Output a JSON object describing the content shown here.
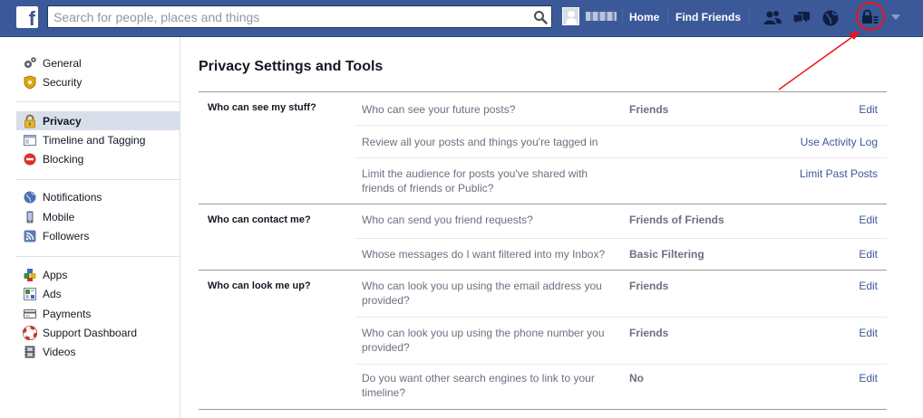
{
  "topbar": {
    "logo": "f",
    "search_placeholder": "Search for people, places and things",
    "home_label": "Home",
    "find_friends_label": "Find Friends",
    "icons": [
      "friend-requests-icon",
      "messages-icon",
      "notifications-globe-icon",
      "privacy-shortcuts-lock-icon",
      "account-menu-arrow-icon"
    ],
    "brand_color": "#3b5998"
  },
  "sidebar": {
    "groups": [
      [
        {
          "label": "General",
          "icon": "gear-icon",
          "selected": false
        },
        {
          "label": "Security",
          "icon": "security-badge-icon",
          "selected": false
        }
      ],
      [
        {
          "label": "Privacy",
          "icon": "lock-icon",
          "selected": true
        },
        {
          "label": "Timeline and Tagging",
          "icon": "timeline-icon",
          "selected": false
        },
        {
          "label": "Blocking",
          "icon": "block-icon",
          "selected": false
        }
      ],
      [
        {
          "label": "Notifications",
          "icon": "globe-icon",
          "selected": false
        },
        {
          "label": "Mobile",
          "icon": "mobile-icon",
          "selected": false
        },
        {
          "label": "Followers",
          "icon": "rss-icon",
          "selected": false
        }
      ],
      [
        {
          "label": "Apps",
          "icon": "apps-cube-icon",
          "selected": false
        },
        {
          "label": "Ads",
          "icon": "ads-icon",
          "selected": false
        },
        {
          "label": "Payments",
          "icon": "credit-card-icon",
          "selected": false
        },
        {
          "label": "Support Dashboard",
          "icon": "lifebuoy-icon",
          "selected": false
        },
        {
          "label": "Videos",
          "icon": "film-icon",
          "selected": false
        }
      ]
    ]
  },
  "main": {
    "title": "Privacy Settings and Tools",
    "sections": [
      {
        "title": "Who can see my stuff?",
        "rows": [
          {
            "question": "Who can see your future posts?",
            "value": "Friends",
            "action": "Edit"
          },
          {
            "question": "Review all your posts and things you're tagged in",
            "value": "",
            "action": "Use Activity Log"
          },
          {
            "question": "Limit the audience for posts you've shared with friends of friends or Public?",
            "value": "",
            "action": "Limit Past Posts"
          }
        ]
      },
      {
        "title": "Who can contact me?",
        "rows": [
          {
            "question": "Who can send you friend requests?",
            "value": "Friends of Friends",
            "action": "Edit"
          },
          {
            "question": "Whose messages do I want filtered into my Inbox?",
            "value": "Basic Filtering",
            "action": "Edit"
          }
        ]
      },
      {
        "title": "Who can look me up?",
        "rows": [
          {
            "question": "Who can look you up using the email address you provided?",
            "value": "Friends",
            "action": "Edit"
          },
          {
            "question": "Who can look you up using the phone number you provided?",
            "value": "Friends",
            "action": "Edit"
          },
          {
            "question": "Do you want other search engines to link to your timeline?",
            "value": "No",
            "action": "Edit"
          }
        ]
      }
    ]
  },
  "annotation_color": "#e8141c"
}
